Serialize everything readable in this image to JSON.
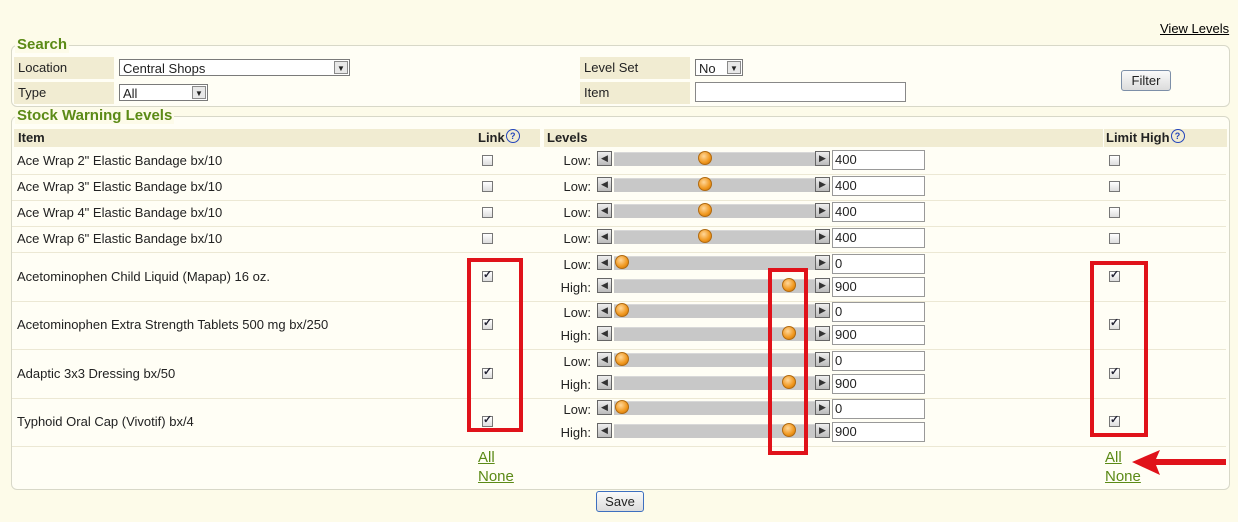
{
  "view_levels": "View Levels",
  "search": {
    "legend": "Search",
    "location_label": "Location",
    "location_value": "Central Shops",
    "type_label": "Type",
    "type_value": "All",
    "level_set_label": "Level Set",
    "level_set_value": "No",
    "item_label": "Item",
    "item_value": "",
    "filter_button": "Filter"
  },
  "stock": {
    "legend": "Stock Warning Levels",
    "headers": {
      "item": "Item",
      "link": "Link",
      "levels": "Levels",
      "limit_high": "Limit High"
    },
    "help": "?",
    "low_label": "Low:",
    "high_label": "High:",
    "rows": [
      {
        "name": "Ace Wrap 2\" Elastic Bandage bx/10",
        "link": false,
        "low": "400",
        "limit_high": false,
        "low_fraction": 0.45
      },
      {
        "name": "Ace Wrap 3\" Elastic Bandage bx/10",
        "link": false,
        "low": "400",
        "limit_high": false,
        "low_fraction": 0.45
      },
      {
        "name": "Ace Wrap 4\" Elastic Bandage bx/10",
        "link": false,
        "low": "400",
        "limit_high": false,
        "low_fraction": 0.45
      },
      {
        "name": "Ace Wrap 6\" Elastic Bandage bx/10",
        "link": false,
        "low": "400",
        "limit_high": false,
        "low_fraction": 0.45
      },
      {
        "name": "Acetominophen Child Liquid (Mapap) 16 oz.",
        "link": true,
        "low": "0",
        "high": "900",
        "limit_high": true,
        "low_fraction": 0.0,
        "high_fraction": 0.9
      },
      {
        "name": "Acetominophen Extra Strength Tablets 500 mg bx/250",
        "link": true,
        "low": "0",
        "high": "900",
        "limit_high": true,
        "low_fraction": 0.0,
        "high_fraction": 0.9
      },
      {
        "name": "Adaptic 3x3 Dressing bx/50",
        "link": true,
        "low": "0",
        "high": "900",
        "limit_high": true,
        "low_fraction": 0.0,
        "high_fraction": 0.9
      },
      {
        "name": "Typhoid Oral Cap (Vivotif) bx/4",
        "link": true,
        "low": "0",
        "high": "900",
        "limit_high": true,
        "low_fraction": 0.0,
        "high_fraction": 0.9
      }
    ],
    "all_label": "All",
    "none_label": "None"
  },
  "save_button": "Save",
  "colors": {
    "highlight": "#e0121a",
    "accent": "#5b8a16",
    "knob": "#f0971d"
  }
}
